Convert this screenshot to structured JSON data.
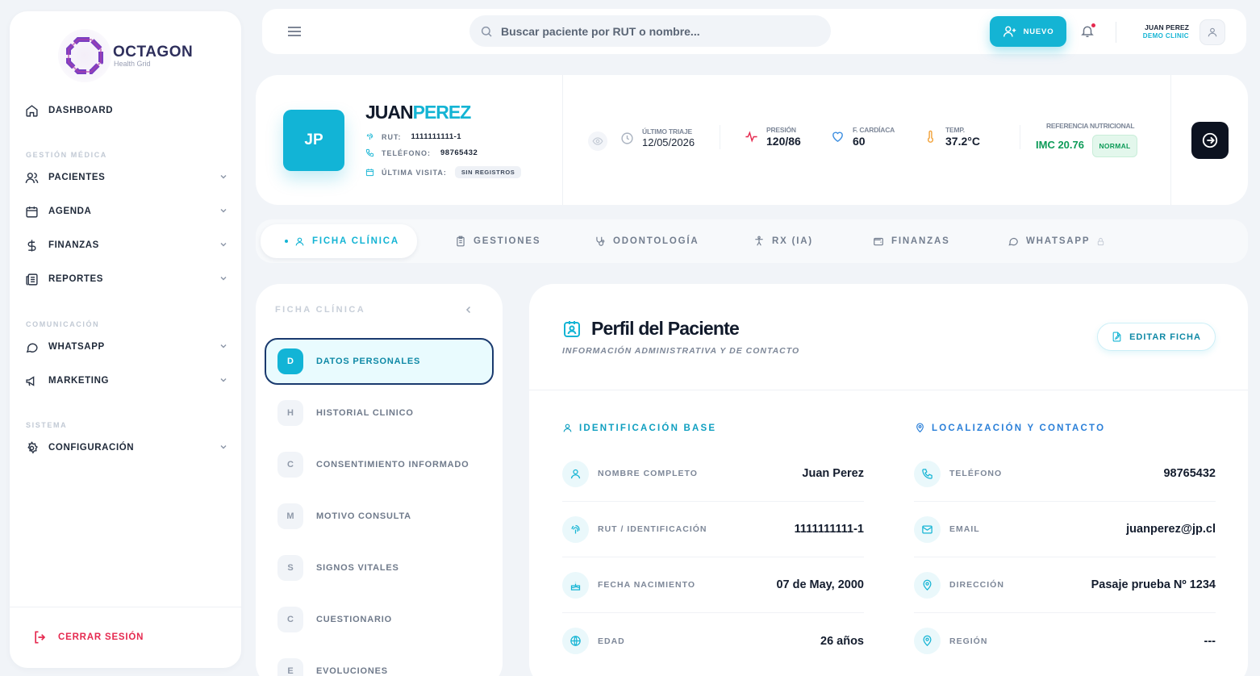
{
  "brand": {
    "title": "OCTAGON",
    "subtitle": "Health Grid"
  },
  "sidebar": {
    "items": {
      "dashboard": "DASHBOARD",
      "pacientes": "PACIENTES",
      "agenda": "AGENDA",
      "finanzas": "FINANZAS",
      "reportes": "REPORTES",
      "whatsapp": "WHATSAPP",
      "marketing": "MARKETING",
      "configuracion": "CONFIGURACIÓN"
    },
    "sections": {
      "gestion": "GESTIÓN MÉDICA",
      "comunicacion": "COMUNICACIÓN",
      "sistema": "SISTEMA"
    },
    "logout": "CERRAR SESIÓN"
  },
  "topbar": {
    "search_placeholder": "Buscar paciente por RUT o nombre...",
    "new_button": "NUEVO",
    "user_name": "JUAN PEREZ",
    "user_org": "DEMO CLINIC"
  },
  "patient": {
    "initials": "JP",
    "first_name": "JUAN",
    "last_name": "PEREZ",
    "rut_label": "RUT:",
    "rut": "1111111111-1",
    "phone_label": "TELÉFONO:",
    "phone": "98765432",
    "last_visit_label": "ÚLTIMA VISITA:",
    "last_visit": "SIN REGISTROS"
  },
  "vitals": {
    "triage_label": "ÚLTIMO TRIAJE",
    "triage_date": "12/05/2026",
    "pressure_label": "PRESIÓN",
    "pressure": "120/86",
    "heart_label": "F. CARDÍACA",
    "heart": "60",
    "temp_label": "TEMP.",
    "temp": "37.2°C",
    "nutrition_label": "REFERENCIA NUTRICIONAL",
    "imc": "IMC 20.76",
    "imc_status": "NORMAL"
  },
  "tabs": {
    "ficha": "FICHA CLÍNICA",
    "gestiones": "GESTIONES",
    "odontologia": "ODONTOLOGÍA",
    "rx": "RX (IA)",
    "finanzas": "FINANZAS",
    "whatsapp": "WHATSAPP"
  },
  "sections_panel": {
    "title": "FICHA CLÍNICA",
    "items": [
      {
        "letter": "D",
        "label": "DATOS PERSONALES"
      },
      {
        "letter": "H",
        "label": "HISTORIAL CLINICO"
      },
      {
        "letter": "C",
        "label": "CONSENTIMIENTO INFORMADO"
      },
      {
        "letter": "M",
        "label": "MOTIVO CONSULTA"
      },
      {
        "letter": "S",
        "label": "SIGNOS VITALES"
      },
      {
        "letter": "C",
        "label": "CUESTIONARIO"
      },
      {
        "letter": "E",
        "label": "EVOLUCIONES"
      }
    ]
  },
  "profile": {
    "title": "Perfil del Paciente",
    "subtitle": "INFORMACIÓN ADMINISTRATIVA Y DE CONTACTO",
    "edit_button": "EDITAR FICHA",
    "identification_title": "IDENTIFICACIÓN BASE",
    "location_title": "LOCALIZACIÓN Y CONTACTO",
    "identification": [
      {
        "label": "NOMBRE COMPLETO",
        "value": "Juan Perez"
      },
      {
        "label": "RUT / IDENTIFICACIÓN",
        "value": "1111111111-1"
      },
      {
        "label": "FECHA NACIMIENTO",
        "value": "07 de May, 2000"
      },
      {
        "label": "EDAD",
        "value": "26 años"
      }
    ],
    "location": [
      {
        "label": "TELÉFONO",
        "value": "98765432"
      },
      {
        "label": "EMAIL",
        "value": "juanperez@jp.cl"
      },
      {
        "label": "DIRECCIÓN",
        "value": "Pasaje prueba Nº 1234"
      },
      {
        "label": "REGIÓN",
        "value": "---"
      }
    ]
  },
  "colors": {
    "accent": "#14b4d4",
    "danger": "#e5294f",
    "success": "#0d9b58",
    "dark": "#0c1220"
  }
}
